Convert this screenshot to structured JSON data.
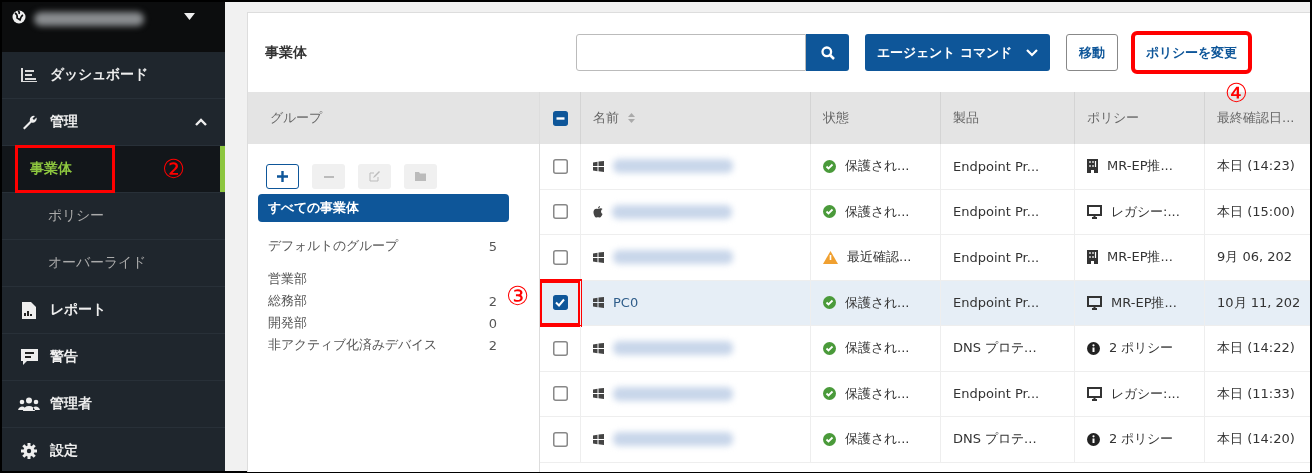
{
  "sidebar": {
    "items": [
      {
        "label": "ダッシュボード",
        "selected": false
      },
      {
        "label": "管理",
        "selected": false,
        "expanded": true,
        "children": [
          {
            "label": "事業体",
            "selected": true,
            "annotation": "②"
          },
          {
            "label": "ポリシー",
            "selected": false
          },
          {
            "label": "オーバーライド",
            "selected": false
          }
        ]
      },
      {
        "label": "レポート",
        "selected": false
      },
      {
        "label": "警告",
        "selected": false
      },
      {
        "label": "管理者",
        "selected": false
      },
      {
        "label": "設定",
        "selected": false
      }
    ]
  },
  "page": {
    "title": "事業体",
    "buttons": [
      {
        "label": "エージェント コマンド",
        "kind": "primary",
        "dropdown": true
      },
      {
        "label": "移動",
        "kind": "outline"
      },
      {
        "label": "ポリシーを変更",
        "kind": "plain",
        "annotation": "④"
      }
    ]
  },
  "groups": {
    "heading": "グループ",
    "items": [
      {
        "label": "すべての事業体",
        "selected": true
      },
      {
        "label": "デフォルトのグループ",
        "count": "5",
        "selected": false
      },
      {
        "label": "営業部",
        "selected": false
      },
      {
        "label": "総務部",
        "count": "2",
        "selected": false
      },
      {
        "label": "開発部",
        "count": "0",
        "selected": false
      },
      {
        "label": "非アクティブ化済みデバイス",
        "count": "2",
        "selected": false
      }
    ]
  },
  "table": {
    "header_checkbox": {
      "indeterminate": true
    },
    "columns": [
      "名前",
      "状態",
      "製品",
      "ポリシー",
      "最終確認日..."
    ],
    "rows": [
      {
        "selected": false,
        "status_text": "保護され...",
        "product": "Endpoint Pr...",
        "policy": "MR-EP推...",
        "last_seen": "本日 (14:23)"
      },
      {
        "selected": false,
        "status_text": "保護され...",
        "product": "Endpoint Pr...",
        "policy": "レガシー:...",
        "last_seen": "本日 (15:00)"
      },
      {
        "selected": false,
        "status_text": "最近確認...",
        "product": "Endpoint Pr...",
        "policy": "MR-EP推...",
        "last_seen": "9月 06, 202"
      },
      {
        "selected": true,
        "name": "PC0",
        "annotation": "③",
        "status_text": "保護され...",
        "product": "Endpoint Pr...",
        "policy": "MR-EP推...",
        "last_seen": "10月 11, 202"
      },
      {
        "selected": false,
        "status_text": "保護され...",
        "product": "DNS プロテ...",
        "policy": "2 ポリシー",
        "last_seen": "本日 (14:22)"
      },
      {
        "selected": false,
        "status_text": "保護され...",
        "product": "Endpoint Pr...",
        "policy": "レガシー:...",
        "last_seen": "本日 (11:33)"
      },
      {
        "selected": false,
        "status_text": "保護され...",
        "product": "DNS プロテ...",
        "policy": "2 ポリシー",
        "last_seen": "本日 (14:20)"
      }
    ]
  }
}
